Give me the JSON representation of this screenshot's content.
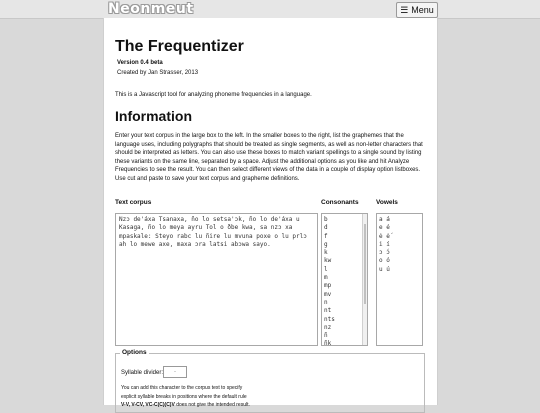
{
  "header": {
    "logo": "Neonmeut",
    "menu_label": "Menu",
    "menu_icon": "hamburger-icon"
  },
  "page": {
    "title": "The Frequentizer",
    "version": "Version 0.4 beta",
    "creator": "Created by Jan Strasser, 2013",
    "intro": "This is a Javascript tool for analyzing phoneme frequencies in a language.",
    "info_heading": "Information",
    "info_text": "Enter your text corpus in the large box to the left. In the smaller boxes to the right, list the graphemes that the language uses, including polygraphs that should be treated as single segments, as well as non-letter characters that should be interpreted as letters. You can also use these boxes to match variant spellings to a single sound by listing these variants on the same line, separated by a space. Adjust the additional options as you like and hit Analyze Frequencies to see the result. You can then select different views of the data in a couple of display option listboxes. Use cut and paste to save your text corpus and grapheme definitions."
  },
  "corpus": {
    "label": "Text corpus",
    "value": "Nzɔ de'áxa Tsanaxa, ño lo setsa'ɔk, ño lo de'áxa u Kasaga, ño lo meya ayru Tol o ðbe kwa, sa nzɔ xa mpaskale: Steyo rabc lu ñire lu mvuna poxe o lu prlɔ ah lo mewe axe, maxa ɔra latsi abɔwa sayo."
  },
  "consonants": {
    "label": "Consonants",
    "items": [
      "b",
      "d",
      "f",
      "g",
      "k",
      "kw",
      "l",
      "m",
      "mp",
      "mv",
      "n",
      "nt",
      "nts",
      "nz",
      "ñ",
      "ñk"
    ]
  },
  "vowels": {
    "label": "Vowels",
    "items": [
      "a á",
      "e é",
      "ė ė́",
      "i í",
      "ɔ ɔ́",
      "o ó",
      "u ú"
    ]
  },
  "options": {
    "legend": "Options",
    "syllable_label": "Syllable divider:",
    "syllable_value": "·",
    "help_line1": "You can add this character to the corpus text to specify",
    "help_line2": "explicit syllable breaks in positions where the default rule",
    "help_line3_bold": "V-V, V-CV, VC-C(C)(C)V",
    "help_line3_rest": " does not give the intended result."
  }
}
